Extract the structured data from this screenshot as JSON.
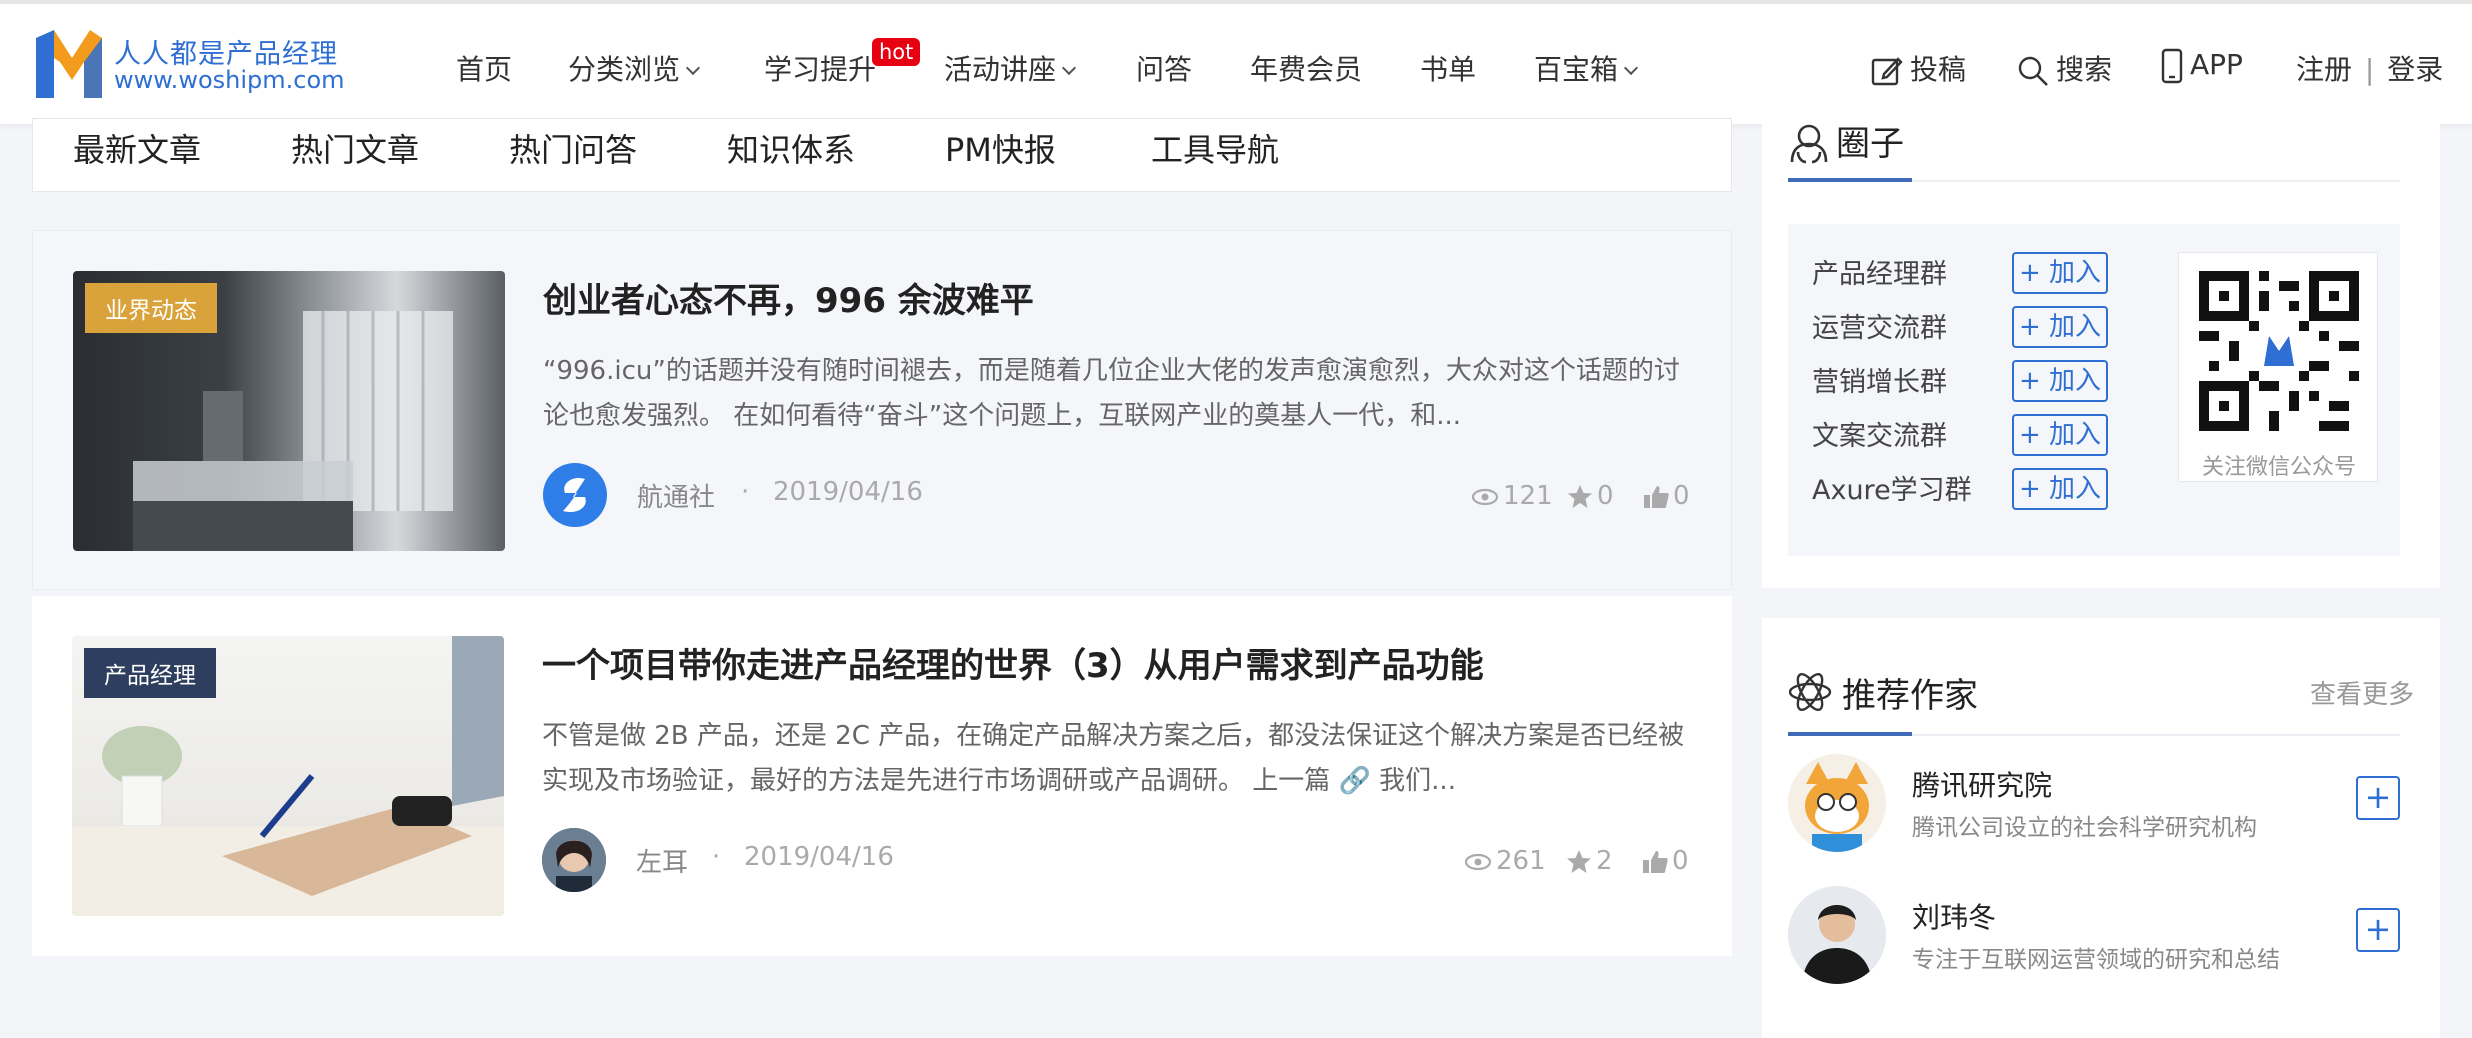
{
  "site": {
    "logo_title": "人人都是产品经理",
    "logo_url": "www.woshipm.com",
    "brand_color": "#2f6fd3"
  },
  "nav": {
    "items": [
      {
        "label": "首页"
      },
      {
        "label": "分类浏览",
        "dropdown": true
      },
      {
        "label": "学习提升",
        "badge": "hot"
      },
      {
        "label": "活动讲座",
        "dropdown": true
      },
      {
        "label": "问答"
      },
      {
        "label": "年费会员"
      },
      {
        "label": "书单"
      },
      {
        "label": "百宝箱",
        "dropdown": true
      }
    ],
    "right": {
      "contribute": "投稿",
      "search": "搜索",
      "app": "APP",
      "register": "注册",
      "separator": "|",
      "login": "登录"
    }
  },
  "tabs": [
    "最新文章",
    "热门文章",
    "热门问答",
    "知识体系",
    "PM快报",
    "工具导航"
  ],
  "articles": [
    {
      "category": "业界动态",
      "category_color": "#d9a23a",
      "title": "创业者心态不再，996 余波难平",
      "excerpt": "“996.icu”的话题并没有随时间褪去，而是随着几位企业大佬的发声愈演愈烈，大众对这个话题的讨论也愈发强烈。 在如何看待“奋斗”这个问题上，互联网产业的奠基人一代，和...",
      "author": "航通社",
      "dot": "·",
      "date": "2019/04/16",
      "views": "121",
      "stars": "0",
      "likes": "0"
    },
    {
      "category": "产品经理",
      "category_color": "#2d3e5e",
      "title": "一个项目带你走进产品经理的世界（3）从用户需求到产品功能",
      "excerpt": "不管是做 2B 产品，还是 2C 产品，在确定产品解决方案之后，都没法保证这个解决方案是否已经被实现及市场验证，最好的方法是先进行市场调研或产品调研。 上一篇 🔗 我们...",
      "author": "左耳",
      "dot": "·",
      "date": "2019/04/16",
      "views": "261",
      "stars": "2",
      "likes": "0"
    }
  ],
  "circle": {
    "title": "圈子",
    "groups": [
      {
        "name": "产品经理群",
        "join": "+ 加入"
      },
      {
        "name": "运营交流群",
        "join": "+ 加入"
      },
      {
        "name": "营销增长群",
        "join": "+ 加入"
      },
      {
        "name": "文案交流群",
        "join": "+ 加入"
      },
      {
        "name": "Axure学习群",
        "join": "+ 加入"
      }
    ],
    "qr_caption": "关注微信公众号"
  },
  "writers": {
    "title": "推荐作家",
    "more": "查看更多",
    "items": [
      {
        "name": "腾讯研究院",
        "desc": "腾讯公司设立的社会科学研究机构",
        "follow": "+"
      },
      {
        "name": "刘玮冬",
        "desc": "专注于互联网运营领域的研究和总结",
        "follow": "+"
      }
    ]
  }
}
